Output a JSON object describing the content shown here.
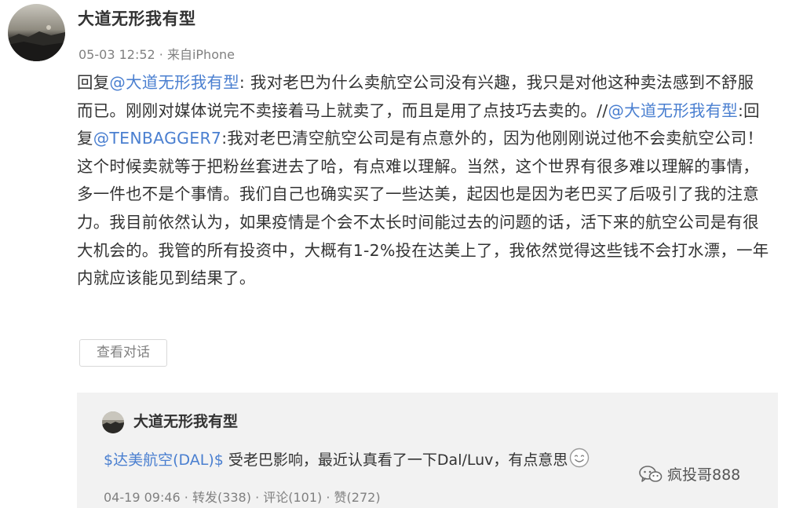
{
  "post": {
    "username": "大道无形我有型",
    "timestamp": "05-03 12:52",
    "meta_sep": " · ",
    "source": "来自iPhone",
    "body": {
      "p1": "回复",
      "m1": "@大道无形我有型",
      "p2": ": 我对老巴为什么卖航空公司没有兴趣，我只是对他这种卖法感到不舒服而已。刚刚对媒体说完不卖接着马上就卖了，而且是用了点技巧去卖的。//",
      "m2": "@大道无形我有型",
      "p3": ":回复",
      "m3": "@TENBAGGER7",
      "p4": ":我对老巴清空航空公司是有点意外的，因为他刚刚说过他不会卖航空公司！这个时候卖就等于把粉丝套进去了哈，有点难以理解。当然，这个世界有很多难以理解的事情，多一件也不是个事情。我们自己也确实买了一些达美，起因也是因为老巴买了后吸引了我的注意力。我目前依然认为，如果疫情是个会不太长时间能过去的问题的话，活下来的航空公司是有很大机会的。我管的所有投资中，大概有1-2%投在达美上了，我依然觉得这些钱不会打水漂，一年内就应该能见到结果了。"
    },
    "view_conversation_label": "查看对话"
  },
  "repost": {
    "username": "大道无形我有型",
    "cashtag": "$达美航空(DAL)$",
    "text": " 受老巴影响，最近认真看了一下Dal/Luv，有点意思",
    "timestamp": "04-19 09:46",
    "sep": " · ",
    "repost_label": "转发(338)",
    "comment_label": "评论(101)",
    "like_label": "赞(272)"
  },
  "watermark": {
    "text": "疯投哥888"
  },
  "colors": {
    "link": "#4a7fd0",
    "text": "#333333",
    "meta": "#808080",
    "repost_bg": "#f2f2f2"
  }
}
